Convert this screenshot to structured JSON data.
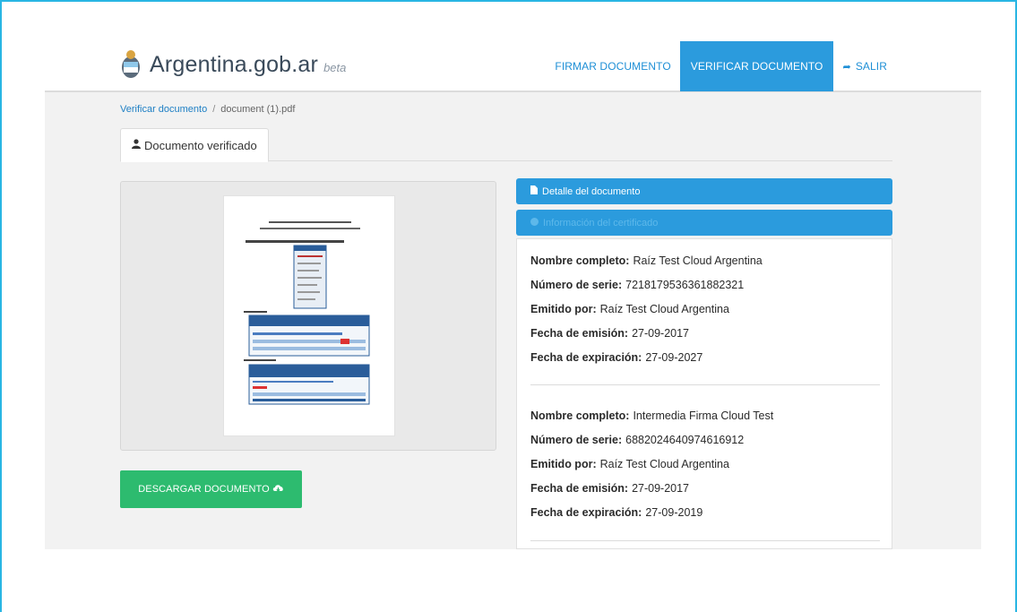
{
  "header": {
    "brand": "Argentina.gob.ar",
    "beta": "beta",
    "nav": {
      "sign": "FIRMAR DOCUMENTO",
      "verify": "VERIFICAR DOCUMENTO",
      "exit": "SALIR"
    }
  },
  "breadcrumb": {
    "root": "Verificar documento",
    "separator": "/",
    "current": "document (1).pdf"
  },
  "tab": {
    "label": "Documento verificado"
  },
  "download_button": {
    "label": "DESCARGAR DOCUMENTO"
  },
  "panels": {
    "detail": "Detalle del documento",
    "certificate": "Información del certificado"
  },
  "certificates": [
    {
      "name_label": "Nombre completo:",
      "name": "Raíz Test Cloud Argentina",
      "serial_label": "Número de serie:",
      "serial": "7218179536361882321",
      "issuer_label": "Emitido por:",
      "issuer": "Raíz Test Cloud Argentina",
      "issued_label": "Fecha de emisión:",
      "issued": "27-09-2017",
      "expires_label": "Fecha de expiración:",
      "expires": "27-09-2027"
    },
    {
      "name_label": "Nombre completo:",
      "name": "Intermedia Firma Cloud Test",
      "serial_label": "Número de serie:",
      "serial": "6882024640974616912",
      "issuer_label": "Emitido por:",
      "issuer": "Raíz Test Cloud Argentina",
      "issued_label": "Fecha de emisión:",
      "issued": "27-09-2017",
      "expires_label": "Fecha de expiración:",
      "expires": "27-09-2019"
    }
  ],
  "icons": {
    "coat_of_arms": "argentina-coat-of-arms-icon",
    "exit": "sign-out-icon",
    "user": "user-icon",
    "file": "file-icon",
    "info": "info-circle-icon",
    "download": "cloud-download-icon"
  },
  "colors": {
    "brand_blue": "#2b9bdd",
    "download_green": "#2dbb6f",
    "frame": "#29b6e3"
  }
}
